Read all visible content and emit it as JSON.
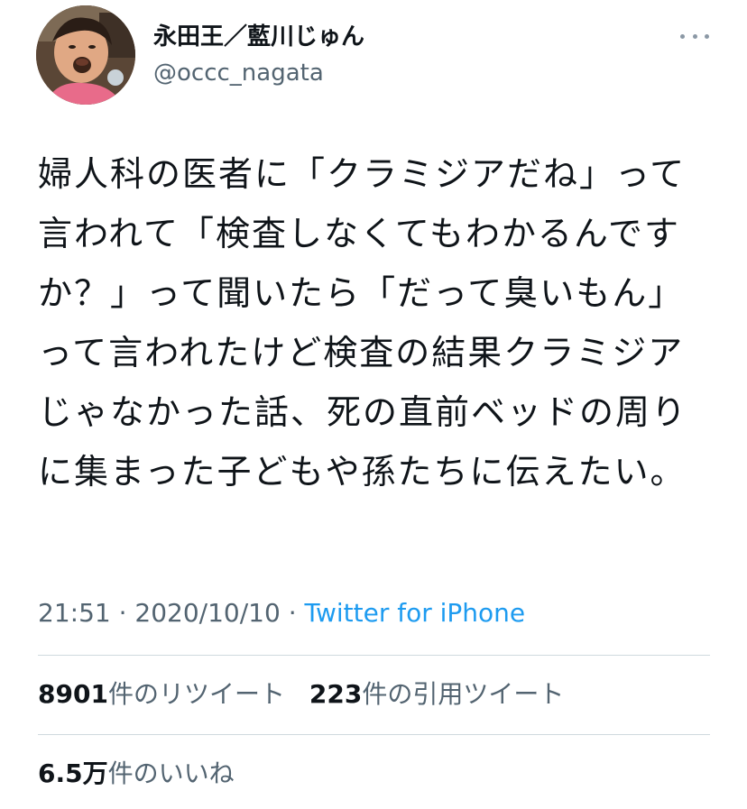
{
  "author": {
    "display_name": "永田王／藍川じゅん",
    "handle": "@occc_nagata",
    "avatar_icon": "profile-photo"
  },
  "tweet": {
    "text": "婦人科の医者に「クラミジアだね」って言われて「検査しなくてもわかるんですか？」って聞いたら「だって臭いもん」って言われたけど検査の結果クラミジアじゃなかった話、死の直前ベッドの周りに集まった子どもや孫たちに伝えたい。",
    "time": "21:51",
    "date": "2020/10/10",
    "separator": " · ",
    "source": "Twitter for iPhone"
  },
  "stats": {
    "retweets": {
      "count": "8901",
      "label": "件のリツイート"
    },
    "quotes": {
      "count": "223",
      "label": "件の引用ツイート"
    },
    "likes": {
      "count": "6.5万",
      "label": "件のいいね"
    }
  },
  "colors": {
    "text": "#0f1419",
    "secondary": "#536471",
    "link": "#1d9bf0",
    "divider": "#cfd9de"
  }
}
